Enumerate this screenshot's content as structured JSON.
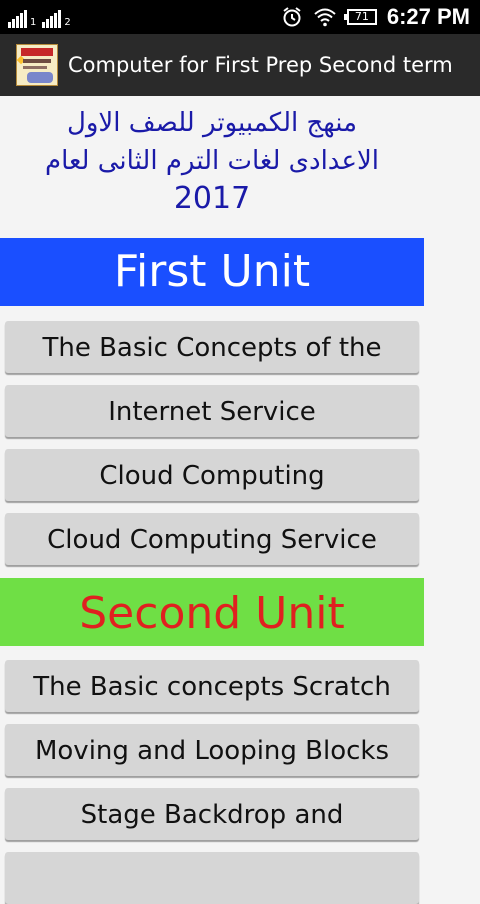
{
  "status_bar": {
    "sim1_label": "1",
    "sim2_label": "2",
    "battery_level": "71",
    "time": "6:27 PM",
    "icons": [
      "signal-icon",
      "signal-icon",
      "alarm-icon",
      "wifi-icon",
      "battery-icon"
    ]
  },
  "app_bar": {
    "title": "Computer for First Prep Second term",
    "icon": "app-logo-icon"
  },
  "header": {
    "arabic_line1": "منهج الكمبيوتر للصف الاول",
    "arabic_line2": "الاعدادى  لغات الترم الثانى لعام",
    "year": "2017"
  },
  "units": [
    {
      "title": "First Unit",
      "color_bg": "#1a4fff",
      "color_fg": "#ffffff",
      "lessons": [
        "The Basic Concepts of the",
        "Internet Service",
        "Cloud Computing",
        "Cloud Computing Service"
      ]
    },
    {
      "title": "Second Unit",
      "color_bg": "#6fdf45",
      "color_fg": "#e02020",
      "lessons": [
        "The Basic concepts Scratch",
        "Moving and Looping Blocks",
        "Stage Backdrop and",
        ""
      ]
    }
  ]
}
